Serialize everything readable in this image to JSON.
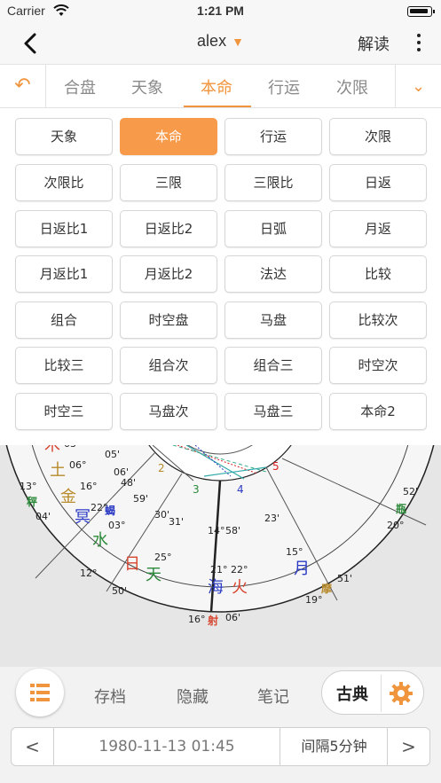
{
  "status": {
    "carrier": "Carrier",
    "time": "1:21 PM"
  },
  "nav": {
    "title": "alex",
    "explain": "解读"
  },
  "tabs": {
    "items": [
      "合盘",
      "天象",
      "本命",
      "行运",
      "次限"
    ],
    "active": "本命"
  },
  "grid": {
    "buttons": [
      "天象",
      "本命",
      "行运",
      "次限",
      "次限比",
      "三限",
      "三限比",
      "日返",
      "日返比1",
      "日返比2",
      "日弧",
      "月返",
      "月返比1",
      "月返比2",
      "法达",
      "比较",
      "组合",
      "时空盘",
      "马盘",
      "比较次",
      "比较三",
      "组合次",
      "组合三",
      "时空次",
      "时空三",
      "马盘次",
      "马盘三",
      "本命2"
    ],
    "selected": "本命"
  },
  "chart": {
    "houses": [
      "2",
      "3",
      "4",
      "5"
    ],
    "planets": [
      {
        "glyph": "木",
        "color": "#d6452f"
      },
      {
        "glyph": "土",
        "color": "#b78a2a"
      },
      {
        "glyph": "金",
        "color": "#b78a2a"
      },
      {
        "glyph": "冥",
        "color": "#2a3ac4"
      },
      {
        "glyph": "水",
        "color": "#2c8a3a"
      },
      {
        "glyph": "日",
        "color": "#d6452f"
      },
      {
        "glyph": "天",
        "color": "#2c8a3a"
      },
      {
        "glyph": "海",
        "color": "#2a3ac4"
      },
      {
        "glyph": "火",
        "color": "#d6452f"
      },
      {
        "glyph": "月",
        "color": "#2a3ac4"
      }
    ],
    "signs": [
      {
        "glyph": "秤",
        "color": "#2c8a3a"
      },
      {
        "glyph": "蝎",
        "color": "#2a3ac4"
      },
      {
        "glyph": "射",
        "color": "#d6452f"
      },
      {
        "glyph": "摩",
        "color": "#b78a2a"
      },
      {
        "glyph": "瓶",
        "color": "#2c8a3a"
      }
    ],
    "labels": [
      "03",
      "06°",
      "05'",
      "06'",
      "16°",
      "48'",
      "13°",
      "04'",
      "22°",
      "59'",
      "30'",
      "31'",
      "03°",
      "25°",
      "14°",
      "58'",
      "12°",
      "50'",
      "21°",
      "22°",
      "16°",
      "06'",
      "23'",
      "15°",
      "51'",
      "19°",
      "52'",
      "20°"
    ]
  },
  "bottom": {
    "archive": "存档",
    "hide": "隐藏",
    "notes": "笔记",
    "classic": "古典",
    "datetime": "1980-11-13 01:45",
    "interval": "间隔5分钟",
    "prev": "<",
    "next": ">"
  },
  "colors": {
    "accent": "#f0953d",
    "selected_button": "#f79a4a"
  }
}
